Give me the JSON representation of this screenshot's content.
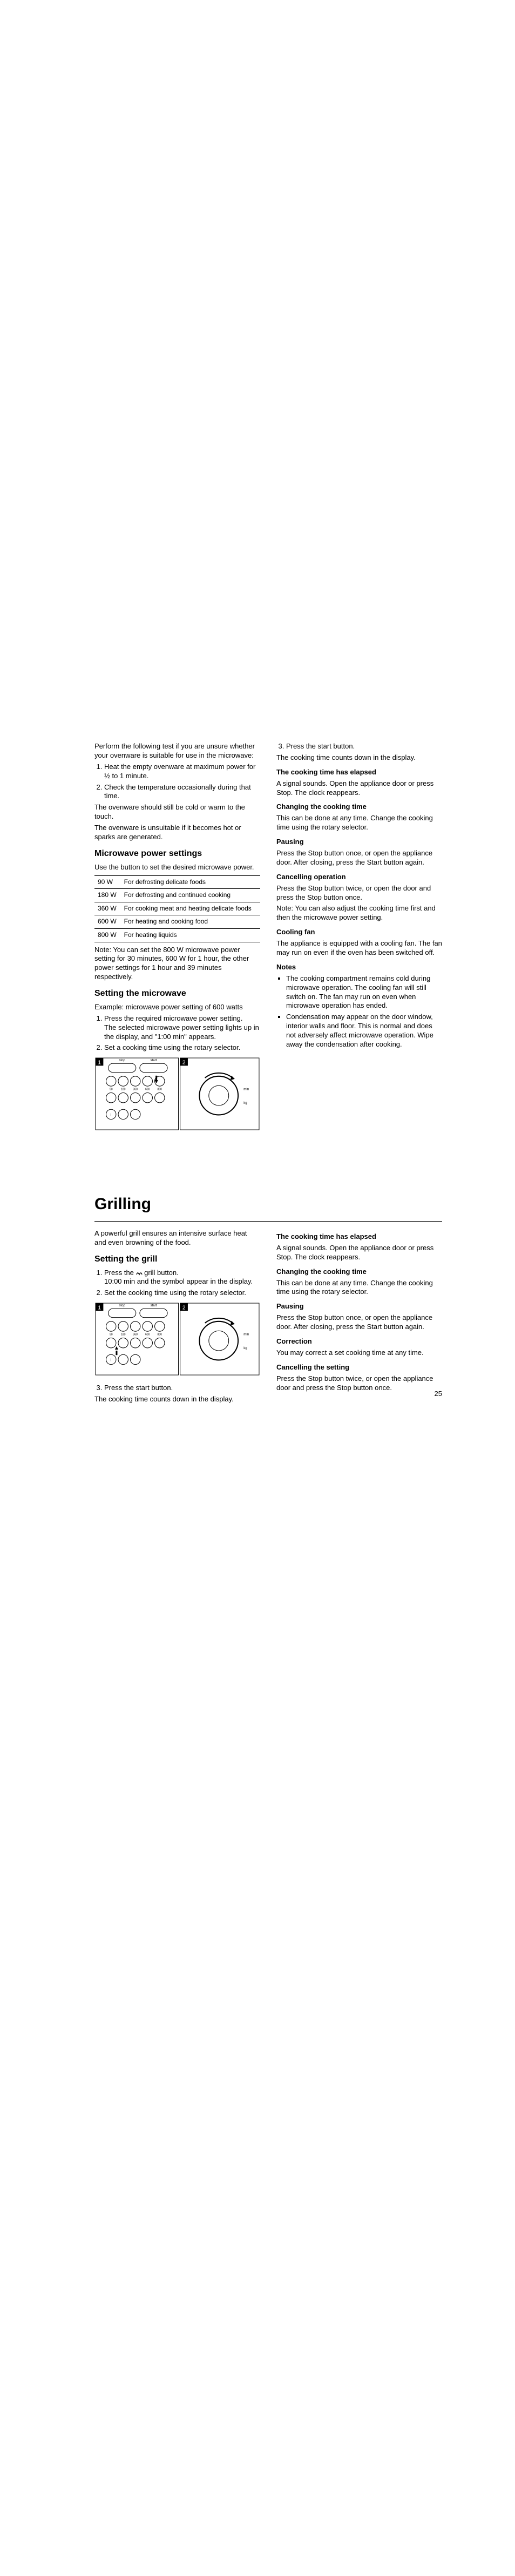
{
  "intro": {
    "p1": "Perform the following test if you are unsure whether your ovenware is suitable for use in the microwave:",
    "li1": "Heat the empty ovenware at maximum power for ½ to 1 minute.",
    "li2": "Check the temperature occasionally during that time.",
    "p2": "The ovenware should still be cold or warm to the touch.",
    "p3": "The ovenware is unsuitable if it becomes hot or sparks are generated."
  },
  "powerSettings": {
    "title": "Microwave power settings",
    "desc": "Use the button to set the desired microwave power.",
    "rows": [
      {
        "w": "90 W",
        "d": "For defrosting delicate foods"
      },
      {
        "w": "180 W",
        "d": "For defrosting and continued cooking"
      },
      {
        "w": "360 W",
        "d": "For cooking meat and heating delicate foods"
      },
      {
        "w": "600 W",
        "d": "For heating and cooking food"
      },
      {
        "w": "800 W",
        "d": "For heating liquids"
      }
    ],
    "note": "Note: You can set the 800 W microwave power setting for 30 minutes, 600 W for 1 hour, the other power settings for 1 hour and 39 minutes respectively."
  },
  "settingMicrowave": {
    "title": "Setting the microwave",
    "example": "Example: microwave power setting of 600 watts",
    "li1": "Press the required microwave power setting.",
    "li1b": "The selected microwave power setting lights up in the display, and \"1:00 min\" appears.",
    "li2": "Set a cooking time using the rotary selector."
  },
  "rightCol": {
    "li3": "Press the start button.",
    "p1": "The cooking time counts down in the display.",
    "h1": "The cooking time has elapsed",
    "p2": "A signal sounds. Open the appliance door or press Stop. The clock reappears.",
    "h2": "Changing the cooking time",
    "p3": "This can be done at any time. Change the cooking time using the rotary selector.",
    "h3": "Pausing",
    "p4": "Press the Stop button once, or open the appliance door. After closing, press the Start button again.",
    "h4": "Cancelling operation",
    "p5": "Press the Stop button twice, or open the door and press the Stop button once.",
    "p6": "Note: You can also adjust the cooking time first and then the microwave power setting.",
    "h5": "Cooling fan",
    "p7": "The appliance is equipped with a cooling fan. The fan may run on even if the oven has been switched off.",
    "h6": "Notes",
    "n1": "The cooking compartment remains cold during microwave operation. The cooling fan will still switch on. The fan may run on even when microwave operation has ended.",
    "n2": "Condensation may appear on the door window, interior walls and floor. This is normal and does not adversely affect microwave operation. Wipe away the condensation after cooking."
  },
  "grilling": {
    "title": "Grilling",
    "desc": "A powerful grill ensures an intensive surface heat and even browning of the food.",
    "settingTitle": "Setting the grill",
    "li1a": "Press the ",
    "li1b": " grill button.",
    "li1c": "10:00 min and the symbol appear in the display.",
    "li2": "Set the cooking time using the rotary selector.",
    "li3": "Press the start button.",
    "p3": "The cooking time counts down in the display.",
    "h1": "The cooking time has elapsed",
    "p4": "A signal sounds. Open the appliance door or press Stop. The clock reappears.",
    "h2": "Changing the cooking time",
    "p5": "This can be done at any time. Change the cooking time using the rotary selector.",
    "h3": "Pausing",
    "p6": "Press the Stop button once, or open the appliance door. After closing, press the Start button again.",
    "h4": "Correction",
    "p7": "You may correct a set cooking time at any time.",
    "h5": "Cancelling the setting",
    "p8": "Press the Stop button twice, or open the appliance door and press the Stop button once."
  },
  "pageNumber": "25"
}
